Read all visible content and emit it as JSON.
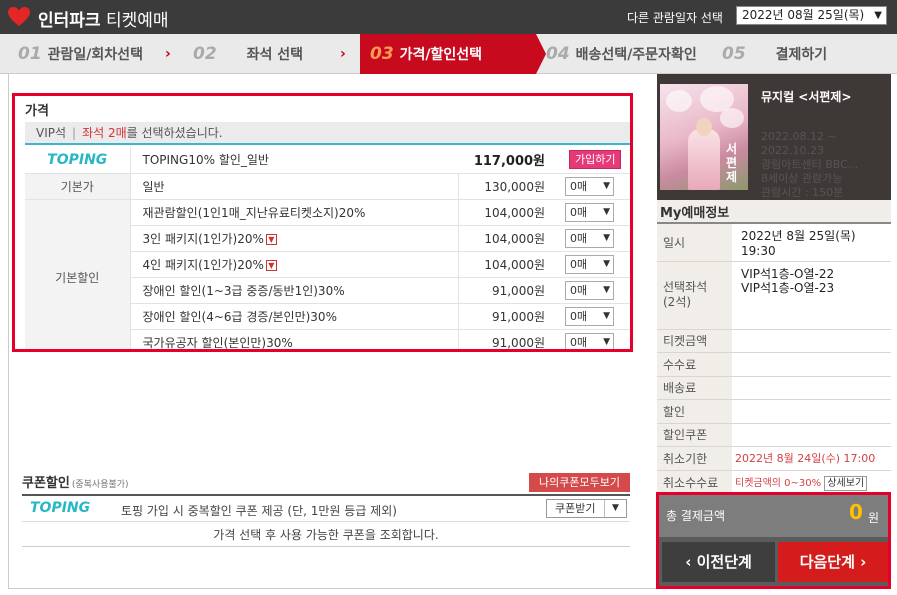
{
  "header": {
    "title_bold": "인터파크",
    "title_thin": " 티켓예매",
    "date_label": "다른 관람일자 선택",
    "date_value": "2022년 08월 25일(목)"
  },
  "steps": [
    {
      "num": "01",
      "label": "관람일/회차선택"
    },
    {
      "num": "02",
      "label": "좌석 선택"
    },
    {
      "num": "03",
      "label": "가격/할인선택"
    },
    {
      "num": "04",
      "label": "배송선택/주문자확인"
    },
    {
      "num": "05",
      "label": "결제하기"
    }
  ],
  "price": {
    "title": "가격",
    "seat_grade": "VIP석",
    "seat_sep": "|",
    "selected_count": "좌석 2매",
    "selected_suffix": "를 선택하셨습니다.",
    "toping_logo": "TOPING",
    "toping_name": "TOPING10% 할인_일반",
    "toping_price": "117,000원",
    "join_label": "가입하기",
    "base_cat": "기본가",
    "base_name": "일반",
    "base_price": "130,000원",
    "disc_cat": "기본할인",
    "qty_default": "0매",
    "discounts": [
      {
        "name": "재관람할인(1인1매_지난유료티켓소지)20%",
        "price": "104,000원"
      },
      {
        "name": "3인 패키지(1인가)20%",
        "price": "104,000원"
      },
      {
        "name": "4인 패키지(1인가)20%",
        "price": "104,000원"
      },
      {
        "name": "장애인 할인(1~3급 중증/동반1인)30%",
        "price": "91,000원"
      },
      {
        "name": "장애인 할인(4~6급 경증/본인만)30%",
        "price": "91,000원"
      },
      {
        "name": "국가유공자 할인(본인만)30%",
        "price": "91,000원"
      }
    ]
  },
  "coupon": {
    "title": "쿠폰할인",
    "title_sub": "(중복사용불가)",
    "my_coupons": "나의쿠폰모두보기",
    "toping_logo": "TOPING",
    "desc": "토핑 가입 시 중복할인 쿠폰 제공 (단, 1만원 등급 제외)",
    "get_label": "쿠폰받기",
    "message": "가격 선택 후 사용 가능한 쿠폰을 조회합니다."
  },
  "show": {
    "poster_text": "서편제",
    "title": "뮤지컬 <서편제>",
    "period_1": "2022.08.12 ~",
    "period_2": "2022.10.23",
    "venue": "광림아트센터 BBC...",
    "age": "8세이상 관람가능",
    "runtime": "관람시간 : 150분"
  },
  "my_info": {
    "title": "My예매정보",
    "datetime_label": "일시",
    "datetime_line1": "2022년 8월 25일(목)",
    "datetime_line2": "19:30",
    "seat_label_1": "선택좌석",
    "seat_label_2": "(2석)",
    "seat_1": "VIP석1층-O열-22",
    "seat_2": "VIP석1층-O열-23",
    "ticket_price": "티켓금액",
    "fee": "수수료",
    "delivery": "배송료",
    "discount": "할인",
    "coupon": "할인쿠폰",
    "cancel_deadline_label": "취소기한",
    "cancel_deadline": "2022년 8월 24일(수) 17:00",
    "cancel_fee_label": "취소수수료",
    "cancel_fee": "티켓금액의 0~30%",
    "detail_btn": "상세보기"
  },
  "total": {
    "label": "총 결제금액",
    "value": "0",
    "unit": "원"
  },
  "nav": {
    "prev": "이전단계",
    "next": "다음단계"
  },
  "colors": {
    "brand_red": "#c80a1e",
    "highlight_red": "#e4002b",
    "toping_teal": "#27b7c5",
    "total_yellow": "#ffc000"
  }
}
